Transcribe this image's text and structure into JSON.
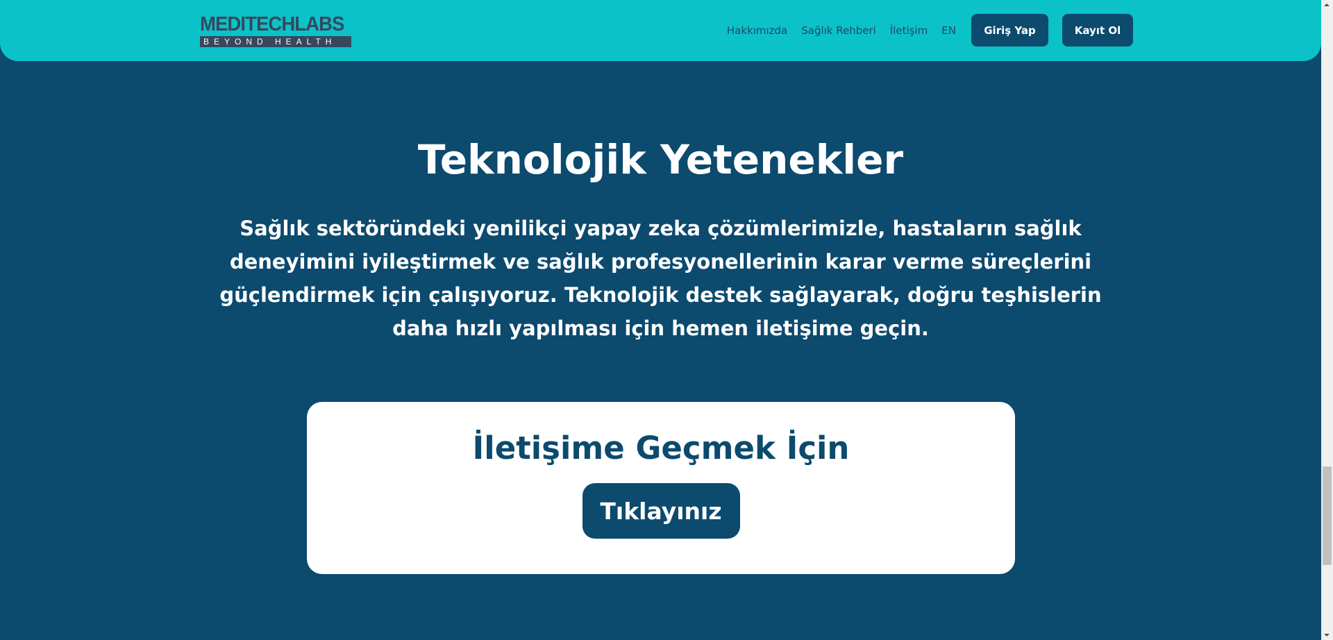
{
  "header": {
    "logo_main": "MEDITECHLABS",
    "logo_sub": "BEYOND HEALTH",
    "nav": [
      "Hakkımızda",
      "Sağlık Rehberi",
      "İletişim",
      "EN"
    ],
    "login": "Giriş Yap",
    "register": "Kayıt Ol"
  },
  "main": {
    "title": "Teknolojik Yetenekler",
    "description": "Sağlık sektöründeki yenilikçi yapay zeka çözümlerimizle, hastaların sağlık deneyimini iyileştirmek ve sağlık profesyonellerinin karar verme süreçlerini güçlendirmek için çalışıyoruz. Teknolojik destek sağlayarak, doğru teşhislerin daha hızlı yapılması için hemen iletişime geçin.",
    "card": {
      "title": "İletişime Geçmek İçin",
      "button": "Tıklayınız"
    }
  },
  "colors": {
    "header": "#0bc2c8",
    "background": "#0c4a6e",
    "card": "#ffffff"
  }
}
